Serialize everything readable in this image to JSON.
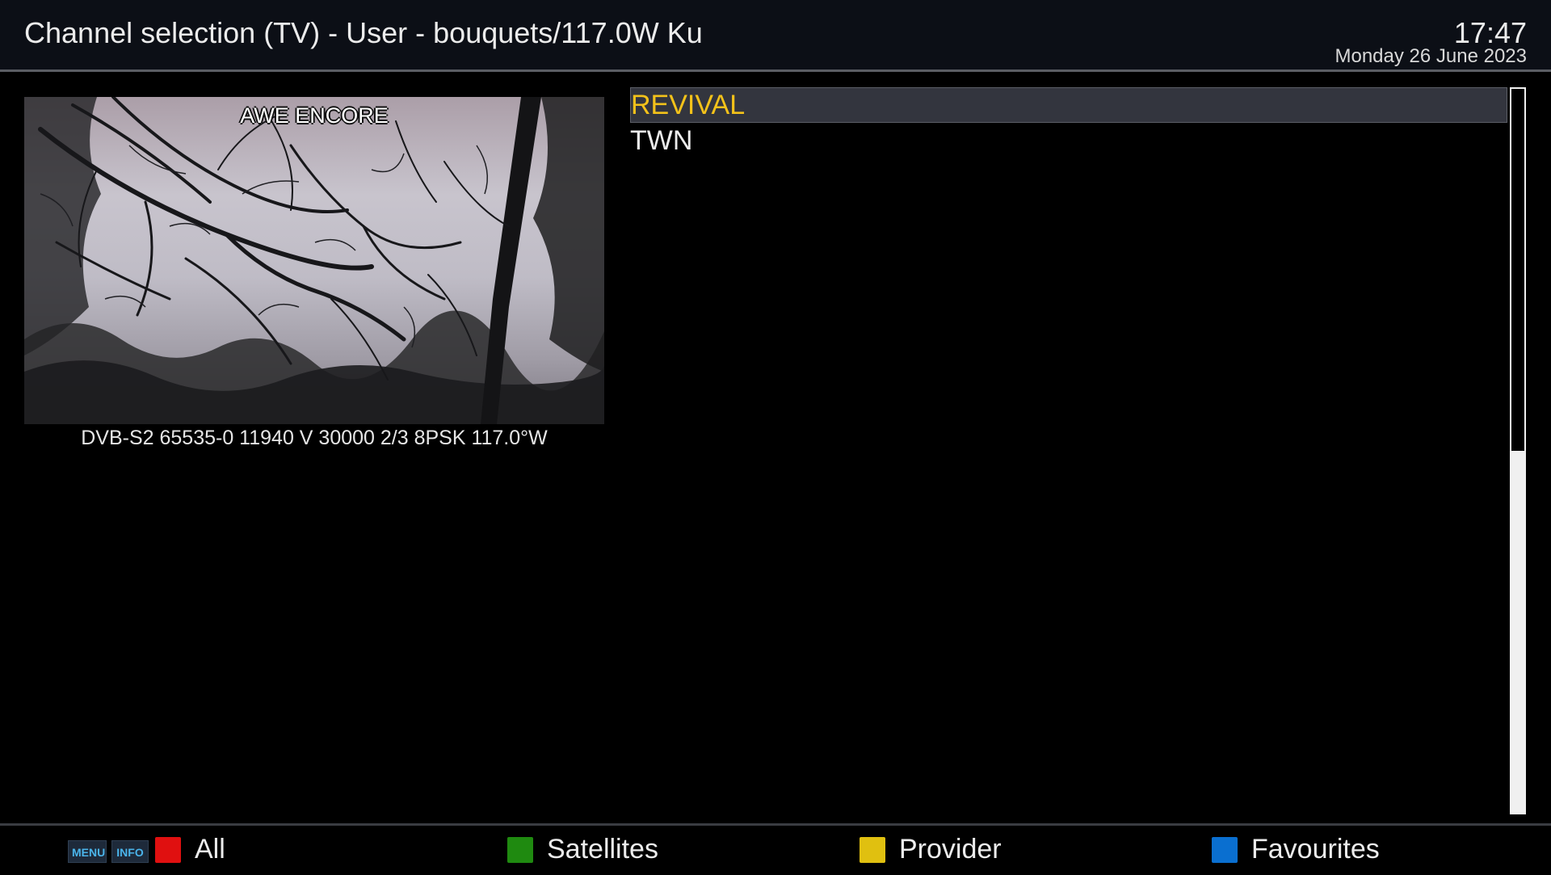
{
  "header": {
    "title": "Channel selection (TV) - User - bouquets/117.0W Ku",
    "time": "17:47",
    "date": "Monday 26 June 2023"
  },
  "preview": {
    "channel_logo": "AWE ENCORE",
    "transponder_info": "DVB-S2 65535-0 11940 V 30000 2/3 8PSK 117.0°W"
  },
  "channels": [
    {
      "name": "REVIVAL",
      "selected": true
    },
    {
      "name": "TWN",
      "selected": false
    }
  ],
  "scroll_position": 0.5,
  "footer": {
    "menu_key": "MENU",
    "info_key": "INFO",
    "buttons": [
      {
        "label": "All",
        "color": "#e01010",
        "icon": "red-key"
      },
      {
        "label": "Satellites",
        "color": "#1f8a10",
        "icon": "green-key"
      },
      {
        "label": "Provider",
        "color": "#e0c010",
        "icon": "yellow-key"
      },
      {
        "label": "Favourites",
        "color": "#0a6fd0",
        "icon": "blue-key"
      }
    ]
  },
  "colors": {
    "selected_text": "#f3c21a",
    "header_bg": "#0c0f16",
    "selected_bg": "#33353e"
  }
}
